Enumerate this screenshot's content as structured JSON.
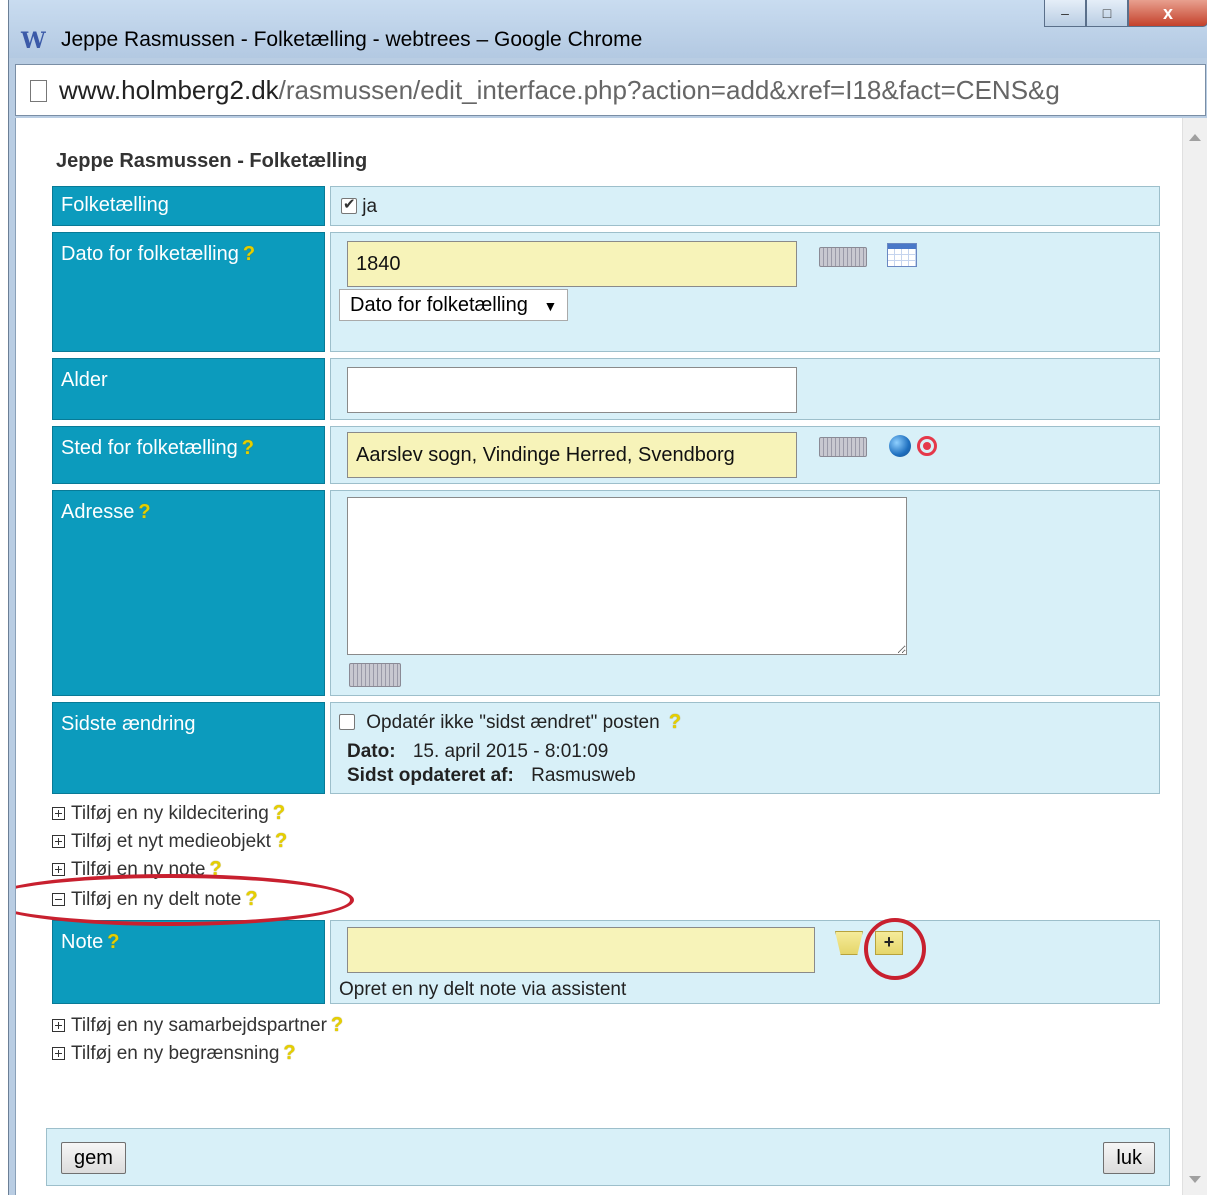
{
  "window": {
    "logo": "W",
    "title": "Jeppe Rasmussen - Folketælling - webtrees – Google Chrome",
    "minimize": "–",
    "maximize": "□",
    "close": "x"
  },
  "address": {
    "host": "www.holmberg2.dk",
    "path": "/rasmussen/edit_interface.php?action=add&xref=I18&fact=CENS&g"
  },
  "page": {
    "title": "Jeppe Rasmussen - Folketælling"
  },
  "help_mark": "?",
  "fields": {
    "census": {
      "label": "Folketælling",
      "checkbox_label": "ja",
      "checked": true
    },
    "date": {
      "label": "Dato for folketælling",
      "value": "1840",
      "select_value": "Dato for folketælling",
      "select_arrow": "▼"
    },
    "age": {
      "label": "Alder",
      "value": ""
    },
    "place": {
      "label": "Sted for folketælling",
      "value": "Aarslev sogn, Vindinge Herred, Svendborg"
    },
    "address": {
      "label": "Adresse",
      "value": ""
    },
    "last_change": {
      "label": "Sidste ændring",
      "checkbox_label": "Opdatér ikke \"sidst ændret\" posten",
      "date_label": "Dato:",
      "date_value": "15. april 2015 - 8:01:09",
      "by_label": "Sidst opdateret af:",
      "by_value": "Rasmusweb"
    },
    "note": {
      "label": "Note",
      "value": "",
      "assistant_text": "Opret en ny delt note via assistent",
      "add_glyph": "+"
    }
  },
  "expanders": {
    "source": "Tilføj en ny kildecitering",
    "media": "Tilføj et nyt medieobjekt",
    "note": "Tilføj en ny note",
    "shared_note": "Tilføj en ny delt note",
    "associate": "Tilføj en ny samarbejdspartner",
    "restriction": "Tilføj en ny begrænsning"
  },
  "buttons": {
    "save": "gem",
    "close": "luk"
  },
  "colors": {
    "label_bg": "#0c9bbd",
    "value_bg": "#d8f0f8",
    "input_highlight": "#f7f3b9",
    "annotation": "#c8202f"
  }
}
